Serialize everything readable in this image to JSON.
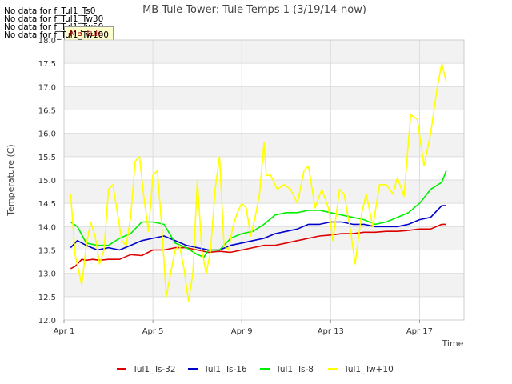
{
  "header": {
    "title": "MB Tule Tower: Tule Temps 1 (3/19/14-now)",
    "no_data": [
      "No data for f_Tul1_Ts0",
      "No data for f_Tul1_Tw30",
      "No data for f_Tul1_Tw50",
      "No data for f_Tul1_Tw100"
    ],
    "tab_label": "MB_tule"
  },
  "colors": {
    "Tul1_Ts-32": "#dd0000",
    "Tul1_Ts-16": "#0000cc",
    "Tul1_Ts-8": "#00ee00",
    "Tul1_Tw+10": "#ffff00"
  },
  "chart_data": {
    "type": "line",
    "title": "MB Tule Tower: Tule Temps 1 (3/19/14-now)",
    "xlabel": "Time",
    "ylabel": "Temperature (C)",
    "x_unit": "day of April 2014",
    "xlim": [
      1,
      19
    ],
    "ylim": [
      12.0,
      18.0
    ],
    "xticks": [
      {
        "value": 1,
        "label": "Apr 1"
      },
      {
        "value": 5,
        "label": "Apr 5"
      },
      {
        "value": 9,
        "label": "Apr 9"
      },
      {
        "value": 13,
        "label": "Apr 13"
      },
      {
        "value": 17,
        "label": "Apr 17"
      }
    ],
    "yticks": [
      "12.0",
      "12.5",
      "13.0",
      "13.5",
      "14.0",
      "14.5",
      "15.0",
      "15.5",
      "16.0",
      "16.5",
      "17.0",
      "17.5",
      "18.0"
    ],
    "grid": true,
    "legend_position": "bottom",
    "series": [
      {
        "name": "Tul1_Ts-32",
        "x": [
          1.3,
          1.5,
          1.8,
          2.0,
          2.3,
          2.6,
          3.0,
          3.5,
          4.0,
          4.5,
          5.0,
          5.5,
          6.0,
          6.5,
          7.0,
          7.5,
          8.0,
          8.5,
          9.0,
          9.5,
          10.0,
          10.5,
          11.0,
          11.5,
          12.0,
          12.5,
          13.0,
          13.5,
          14.0,
          14.5,
          15.0,
          15.5,
          16.0,
          16.5,
          17.0,
          17.5,
          18.0,
          18.2
        ],
        "y": [
          13.1,
          13.15,
          13.3,
          13.28,
          13.3,
          13.28,
          13.3,
          13.3,
          13.4,
          13.38,
          13.5,
          13.5,
          13.55,
          13.55,
          13.5,
          13.45,
          13.47,
          13.45,
          13.5,
          13.55,
          13.6,
          13.6,
          13.65,
          13.7,
          13.75,
          13.8,
          13.82,
          13.85,
          13.85,
          13.88,
          13.88,
          13.9,
          13.9,
          13.92,
          13.95,
          13.95,
          14.05,
          14.05
        ]
      },
      {
        "name": "Tul1_Ts-16",
        "x": [
          1.3,
          1.6,
          2.0,
          2.5,
          3.0,
          3.5,
          4.0,
          4.5,
          5.0,
          5.5,
          6.0,
          6.5,
          7.0,
          7.5,
          8.0,
          8.5,
          9.0,
          9.5,
          10.0,
          10.5,
          11.0,
          11.5,
          12.0,
          12.5,
          13.0,
          13.5,
          14.0,
          14.5,
          15.0,
          15.5,
          16.0,
          16.5,
          17.0,
          17.5,
          18.0,
          18.2
        ],
        "y": [
          13.55,
          13.7,
          13.6,
          13.5,
          13.55,
          13.5,
          13.6,
          13.7,
          13.75,
          13.8,
          13.7,
          13.6,
          13.55,
          13.5,
          13.5,
          13.6,
          13.65,
          13.7,
          13.75,
          13.85,
          13.9,
          13.95,
          14.05,
          14.05,
          14.1,
          14.1,
          14.05,
          14.05,
          14.0,
          14.0,
          14.0,
          14.05,
          14.15,
          14.2,
          14.45,
          14.45
        ]
      },
      {
        "name": "Tul1_Ts-8",
        "x": [
          1.3,
          1.6,
          2.0,
          2.5,
          3.0,
          3.5,
          4.0,
          4.5,
          5.0,
          5.5,
          6.0,
          6.5,
          7.0,
          7.3,
          7.5,
          8.0,
          8.5,
          9.0,
          9.5,
          10.0,
          10.5,
          11.0,
          11.5,
          12.0,
          12.5,
          13.0,
          13.5,
          14.0,
          14.5,
          15.0,
          15.5,
          16.0,
          16.5,
          17.0,
          17.5,
          18.0,
          18.2
        ],
        "y": [
          14.1,
          14.0,
          13.65,
          13.6,
          13.6,
          13.75,
          13.85,
          14.1,
          14.1,
          14.05,
          13.65,
          13.55,
          13.4,
          13.35,
          13.5,
          13.5,
          13.75,
          13.85,
          13.9,
          14.05,
          14.25,
          14.3,
          14.3,
          14.35,
          14.35,
          14.3,
          14.25,
          14.2,
          14.15,
          14.05,
          14.1,
          14.2,
          14.3,
          14.5,
          14.8,
          14.95,
          15.2
        ]
      },
      {
        "name": "Tul1_Tw+10",
        "x": [
          1.3,
          1.5,
          1.8,
          2.0,
          2.2,
          2.4,
          2.6,
          2.8,
          3.0,
          3.2,
          3.4,
          3.6,
          3.8,
          4.0,
          4.2,
          4.4,
          4.6,
          4.8,
          5.0,
          5.2,
          5.4,
          5.6,
          5.8,
          6.0,
          6.2,
          6.4,
          6.6,
          6.8,
          7.0,
          7.2,
          7.4,
          7.6,
          7.8,
          8.0,
          8.2,
          8.4,
          8.6,
          8.8,
          9.0,
          9.2,
          9.4,
          9.6,
          9.8,
          10.0,
          10.1,
          10.3,
          10.6,
          10.9,
          11.2,
          11.5,
          11.8,
          12.0,
          12.3,
          12.6,
          12.9,
          13.1,
          13.4,
          13.6,
          13.9,
          14.1,
          14.4,
          14.6,
          14.9,
          15.2,
          15.5,
          15.8,
          16.0,
          16.3,
          16.6,
          16.9,
          17.2,
          17.5,
          17.8,
          18.0,
          18.2
        ],
        "y": [
          14.7,
          13.4,
          12.75,
          13.6,
          14.1,
          13.8,
          13.2,
          13.5,
          14.8,
          14.9,
          14.3,
          13.7,
          13.6,
          14.2,
          15.4,
          15.5,
          14.6,
          13.9,
          15.1,
          15.2,
          14.0,
          12.5,
          13.0,
          13.5,
          13.6,
          13.1,
          12.4,
          13.0,
          15.0,
          13.5,
          13.0,
          13.5,
          14.8,
          15.5,
          13.6,
          13.5,
          14.0,
          14.3,
          14.5,
          14.4,
          13.8,
          14.2,
          14.7,
          15.8,
          15.1,
          15.1,
          14.8,
          14.9,
          14.8,
          14.5,
          15.2,
          15.3,
          14.4,
          14.8,
          14.4,
          13.7,
          14.8,
          14.7,
          13.9,
          13.2,
          14.3,
          14.7,
          14.0,
          14.9,
          14.9,
          14.7,
          15.05,
          14.65,
          16.4,
          16.3,
          15.3,
          16.0,
          17.0,
          17.5,
          17.1
        ]
      }
    ]
  }
}
